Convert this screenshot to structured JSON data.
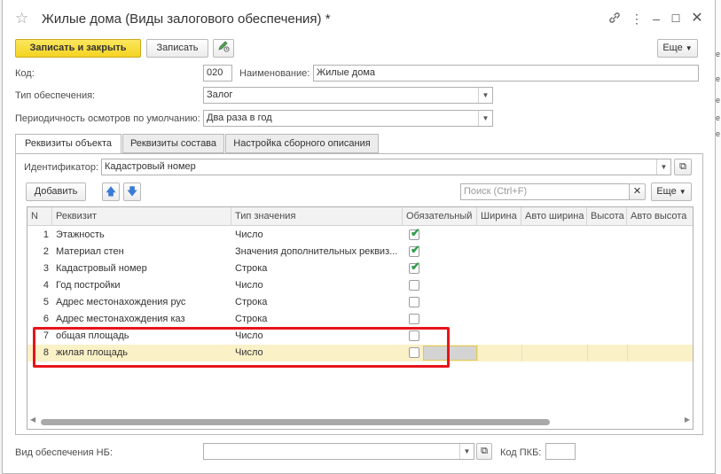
{
  "window": {
    "title": "Жилые дома (Виды залогового обеспечения) *",
    "icons": [
      "link-icon",
      "more-icon",
      "minimize-icon",
      "maximize-icon",
      "close-icon"
    ]
  },
  "toolbar": {
    "save_close_label": "Записать и закрыть",
    "save_label": "Записать",
    "more_label": "Еще"
  },
  "form": {
    "code_label": "Код:",
    "code_value": "020",
    "name_label": "Наименование:",
    "name_value": "Жилые дома",
    "type_label": "Тип обеспечения:",
    "type_value": "Залог",
    "period_label": "Периодичность осмотров по умолчанию:",
    "period_value": "Два раза в год"
  },
  "tabs": [
    {
      "label": "Реквизиты объекта"
    },
    {
      "label": "Реквизиты состава"
    },
    {
      "label": "Настройка сборного описания"
    }
  ],
  "object_tab": {
    "identifier_label": "Идентификатор:",
    "identifier_value": "Кадастровый номер",
    "add_label": "Добавить",
    "search_placeholder": "Поиск (Ctrl+F)",
    "more_label": "Еще"
  },
  "table": {
    "columns": [
      "N",
      "Реквизит",
      "Тип значения",
      "Обязательный",
      "Ширина",
      "Авто ширина",
      "Высота",
      "Авто высота"
    ],
    "rows": [
      {
        "n": "1",
        "name": "Этажность",
        "type": "Число",
        "required": true
      },
      {
        "n": "2",
        "name": "Материал стен",
        "type": "Значения дополнительных реквиз...",
        "required": true
      },
      {
        "n": "3",
        "name": "Кадастровый номер",
        "type": "Строка",
        "required": true
      },
      {
        "n": "4",
        "name": "Год постройки",
        "type": "Число",
        "required": false
      },
      {
        "n": "5",
        "name": "Адрес местонахождения рус",
        "type": "Строка",
        "required": false
      },
      {
        "n": "6",
        "name": "Адрес местонахождения каз",
        "type": "Строка",
        "required": false
      },
      {
        "n": "7",
        "name": "общая площадь",
        "type": "Число",
        "required": false
      },
      {
        "n": "8",
        "name": "жилая площадь",
        "type": "Число",
        "required": false
      }
    ]
  },
  "footer": {
    "nb_label": "Вид обеспечения НБ:",
    "nb_value": "",
    "pkb_label": "Код ПКБ:",
    "pkb_value": ""
  },
  "colors": {
    "primary_button": "#f4d321",
    "highlight_row": "#fbf1c7",
    "annotation_box": "#e8141b",
    "check": "#2e9d4a"
  }
}
